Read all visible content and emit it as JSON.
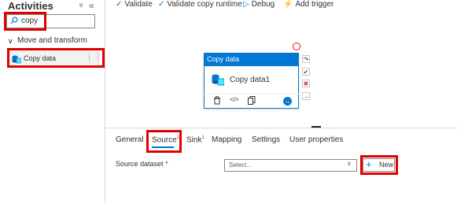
{
  "left_pane": {
    "title": "Activities",
    "collapse_all_icon": "double-chevron-down-icon",
    "collapse_all_glyph": "»",
    "hide_pane_glyph": "«",
    "search": {
      "value": "copy",
      "icon": "search-icon",
      "icon_glyph": "⌕"
    },
    "group": {
      "label": "Move and transform",
      "chevron_glyph": "∨"
    },
    "activity": {
      "label": "Copy data",
      "icon": "copy-data-icon"
    }
  },
  "toolbar": {
    "validate": "Validate",
    "validate_runtime": "Validate copy runtime",
    "debug": "Debug",
    "add_trigger": "Add trigger",
    "check_glyph": "✓",
    "debug_glyph": "▷",
    "trigger_glyph": "⚡"
  },
  "canvas": {
    "card_header": "Copy data",
    "card_name": "Copy data1",
    "icons": {
      "delete": "🗑",
      "code": "</>",
      "copy": "⧉",
      "go": "→"
    },
    "side_buttons": [
      {
        "name": "skip-arrow-icon",
        "glyph": "↷",
        "color": "#605e5c"
      },
      {
        "name": "success-check-icon",
        "glyph": "✔",
        "color": "#107c10"
      },
      {
        "name": "failure-x-icon",
        "glyph": "✖",
        "color": "#d13438"
      },
      {
        "name": "completion-arrow-icon",
        "glyph": "→",
        "color": "#0078d4"
      }
    ]
  },
  "properties": {
    "tabs": [
      {
        "label": "General",
        "badge": ""
      },
      {
        "label": "Source",
        "badge": "1"
      },
      {
        "label": "Sink",
        "badge": "1"
      },
      {
        "label": "Mapping",
        "badge": ""
      },
      {
        "label": "Settings",
        "badge": ""
      },
      {
        "label": "User properties",
        "badge": ""
      }
    ],
    "active_tab": "Source",
    "source_dataset": {
      "label": "Source dataset",
      "required_mark": "*",
      "select_placeholder": "Select...",
      "chevron_glyph": "∨",
      "new_button_label": "New",
      "new_button_glyph": "+"
    }
  },
  "colors": {
    "accent": "#0078d4",
    "highlight_red": "#e00000",
    "required": "#a4262c"
  }
}
